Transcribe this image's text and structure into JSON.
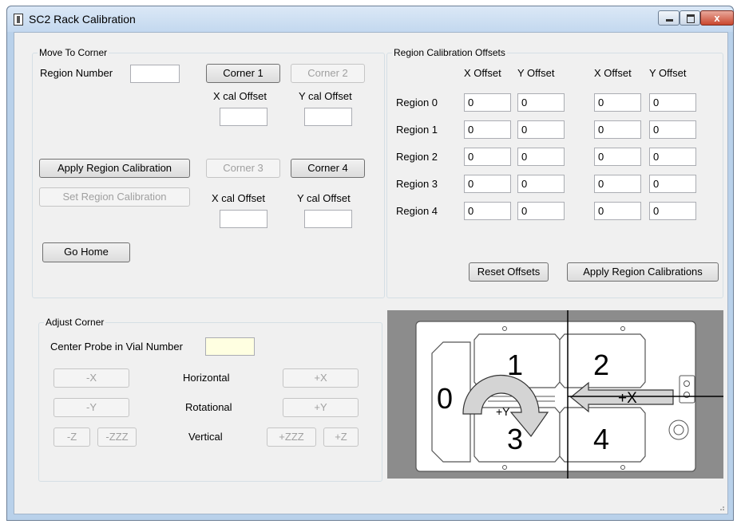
{
  "window": {
    "title": "SC2 Rack Calibration",
    "close_glyph": "x"
  },
  "move_to_corner": {
    "group_label": "Move To Corner",
    "region_number_label": "Region Number",
    "region_number_value": "",
    "corner1": "Corner 1",
    "corner2": "Corner 2",
    "corner3": "Corner 3",
    "corner4": "Corner 4",
    "x_cal_offset": "X cal Offset",
    "y_cal_offset": "Y cal Offset",
    "apply_region_calibration": "Apply Region Calibration",
    "set_region_calibration": "Set Region Calibration",
    "go_home": "Go Home"
  },
  "offsets": {
    "group_label": "Region Calibration Offsets",
    "x_offset": "X Offset",
    "y_offset": "Y Offset",
    "regions": [
      {
        "label": "Region 0",
        "values": [
          "0",
          "0",
          "0",
          "0"
        ]
      },
      {
        "label": "Region 1",
        "values": [
          "0",
          "0",
          "0",
          "0"
        ]
      },
      {
        "label": "Region 2",
        "values": [
          "0",
          "0",
          "0",
          "0"
        ]
      },
      {
        "label": "Region 3",
        "values": [
          "0",
          "0",
          "0",
          "0"
        ]
      },
      {
        "label": "Region 4",
        "values": [
          "0",
          "0",
          "0",
          "0"
        ]
      }
    ],
    "reset_offsets": "Reset Offsets",
    "apply_region_calibrations": "Apply Region Calibrations"
  },
  "adjust_corner": {
    "group_label": "Adjust Corner",
    "center_probe_label": "Center Probe in Vial Number",
    "center_probe_value": "",
    "minus_x": "-X",
    "horizontal": "Horizontal",
    "plus_x": "+X",
    "minus_y": "-Y",
    "rotational": "Rotational",
    "plus_y": "+Y",
    "minus_z": "-Z",
    "minus_zzz": "-ZZZ",
    "vertical": "Vertical",
    "plus_zzz": "+ZZZ",
    "plus_z": "+Z"
  },
  "diagram": {
    "region0": "0",
    "region1": "1",
    "region2": "2",
    "region3": "3",
    "region4": "4",
    "plus_x": "+X",
    "plus_y": "+Y"
  }
}
